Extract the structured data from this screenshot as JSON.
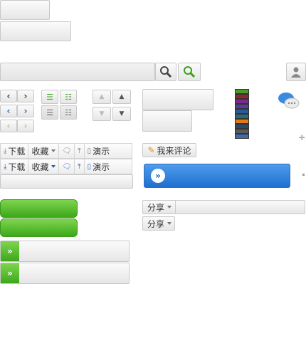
{
  "toolbar_a": {
    "download": "下载",
    "favorite": "收藏",
    "comment_icon": "speech-bubble-icon",
    "top_icon": "to-top-icon",
    "present": "演示"
  },
  "toolbar_b": {
    "download": "下载",
    "favorite": "收藏",
    "present": "演示"
  },
  "comment_button": {
    "label": "我来评论"
  },
  "share_a": {
    "label": "分享"
  },
  "share_b": {
    "label": "分享"
  },
  "colors": {
    "green": "#4caf22",
    "blue": "#2a7be0",
    "active_blue": "#1e63c2"
  },
  "swatches": [
    "#4c9a2a",
    "#8a2a2a",
    "#7a2a8a",
    "#5a3a9a",
    "#2a5a9a",
    "#2a6a7a",
    "#e07a1a",
    "#2a4a6a",
    "#5a5a5a",
    "#3a6ab0"
  ]
}
